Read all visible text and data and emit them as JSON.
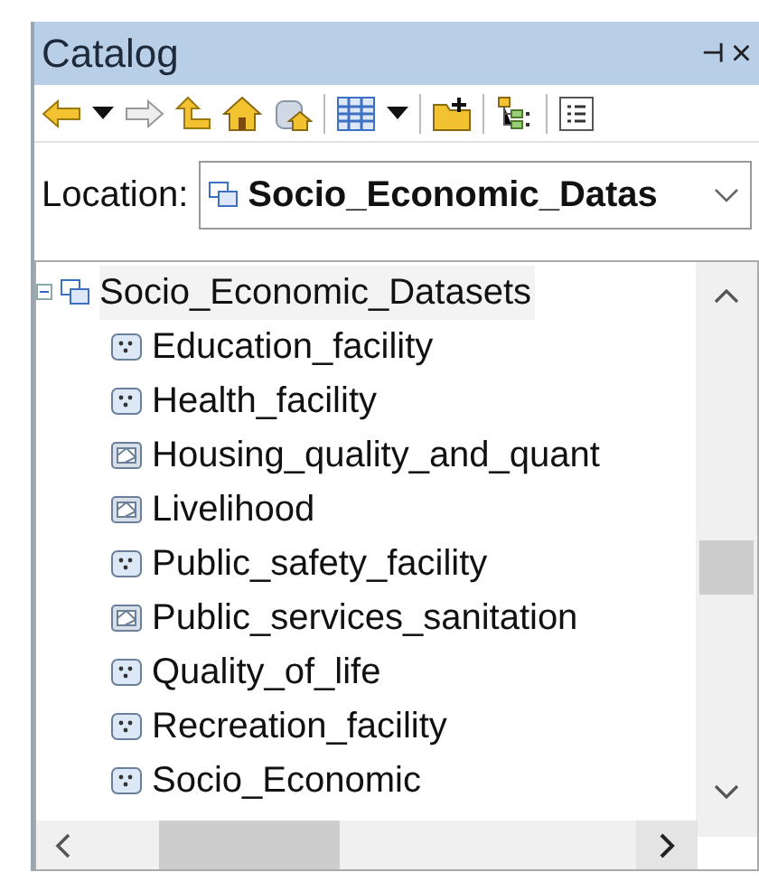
{
  "window": {
    "title": "Catalog",
    "pin_glyph": "⊣",
    "close_glyph": "×"
  },
  "location": {
    "label": "Location:",
    "value": "Socio_Economic_Datas"
  },
  "tree": {
    "label": "Socio_Economic_Datasets",
    "expanded": true,
    "selected": true,
    "children": [
      {
        "label": "Education_facility",
        "kind": "point",
        "selected": false
      },
      {
        "label": "Health_facility",
        "kind": "point",
        "selected": false
      },
      {
        "label": "Housing_quality_and_quant",
        "kind": "polygon",
        "selected": false
      },
      {
        "label": "Livelihood",
        "kind": "polygon",
        "selected": false
      },
      {
        "label": "Public_safety_facility",
        "kind": "point",
        "selected": false
      },
      {
        "label": "Public_services_sanitation",
        "kind": "polygon",
        "selected": false
      },
      {
        "label": "Quality_of_life",
        "kind": "point",
        "selected": false
      },
      {
        "label": "Recreation_facility",
        "kind": "point",
        "selected": false
      },
      {
        "label": "Socio_Economic",
        "kind": "point",
        "selected": false
      }
    ]
  }
}
